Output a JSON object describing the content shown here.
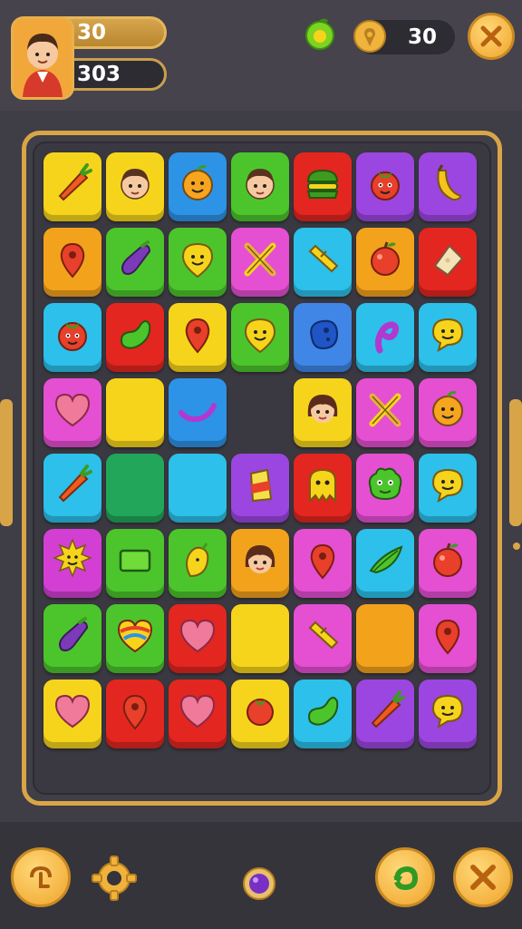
{
  "hud": {
    "level_value": "30",
    "score_value": "303",
    "coins_value": "30"
  },
  "colors": {
    "yellow": "#f6d41c",
    "blue": "#2d93e6",
    "green": "#4cc52c",
    "red": "#e3261f",
    "purple": "#9b46e0",
    "orange": "#f3a21b",
    "cyan": "#2cc0ea",
    "pink": "#e54fd2",
    "dgreen": "#22a65a",
    "lblue": "#3f86e6",
    "magenta": "#d33fd3",
    "gold": "#d9a548"
  },
  "board": {
    "rows": 8,
    "cols": 7,
    "tiles": [
      {
        "row": 0,
        "col": 0,
        "color": "yellow",
        "icon": "carrot-icon"
      },
      {
        "row": 0,
        "col": 1,
        "color": "yellow",
        "icon": "boy-face-icon"
      },
      {
        "row": 0,
        "col": 2,
        "color": "blue",
        "icon": "orange-face-icon"
      },
      {
        "row": 0,
        "col": 3,
        "color": "green",
        "icon": "boy-face-icon"
      },
      {
        "row": 0,
        "col": 4,
        "color": "red",
        "icon": "burger-icon"
      },
      {
        "row": 0,
        "col": 5,
        "color": "purple",
        "icon": "tomato-face-icon"
      },
      {
        "row": 0,
        "col": 6,
        "color": "purple",
        "icon": "banana-icon"
      },
      {
        "row": 1,
        "col": 0,
        "color": "orange",
        "icon": "pepper-icon"
      },
      {
        "row": 1,
        "col": 1,
        "color": "green",
        "icon": "eggplant-icon"
      },
      {
        "row": 1,
        "col": 2,
        "color": "green",
        "icon": "smiley-icon"
      },
      {
        "row": 1,
        "col": 3,
        "color": "pink",
        "icon": "crossed-sticks-icon"
      },
      {
        "row": 1,
        "col": 4,
        "color": "cyan",
        "icon": "bar-icon"
      },
      {
        "row": 1,
        "col": 5,
        "color": "orange",
        "icon": "apple-icon"
      },
      {
        "row": 1,
        "col": 6,
        "color": "red",
        "icon": "cheese-icon"
      },
      {
        "row": 2,
        "col": 0,
        "color": "cyan",
        "icon": "tomato-face-icon"
      },
      {
        "row": 2,
        "col": 1,
        "color": "red",
        "icon": "bean-icon"
      },
      {
        "row": 2,
        "col": 2,
        "color": "yellow",
        "icon": "pepper-icon"
      },
      {
        "row": 2,
        "col": 3,
        "color": "green",
        "icon": "smiley-icon"
      },
      {
        "row": 2,
        "col": 4,
        "color": "lblue",
        "icon": "blob-icon"
      },
      {
        "row": 2,
        "col": 5,
        "color": "cyan",
        "icon": "swirl-icon"
      },
      {
        "row": 2,
        "col": 6,
        "color": "cyan",
        "icon": "speech-smiley-icon"
      },
      {
        "row": 3,
        "col": 0,
        "color": "pink",
        "icon": "heart-icon"
      },
      {
        "row": 3,
        "col": 1,
        "color": "yellow",
        "icon": ""
      },
      {
        "row": 3,
        "col": 2,
        "color": "blue",
        "icon": "curve-icon"
      },
      {
        "row": 3,
        "col": 4,
        "color": "yellow",
        "icon": "girl-face-icon"
      },
      {
        "row": 3,
        "col": 5,
        "color": "pink",
        "icon": "crossed-sticks-icon"
      },
      {
        "row": 3,
        "col": 6,
        "color": "pink",
        "icon": "orange-face-icon"
      },
      {
        "row": 4,
        "col": 0,
        "color": "cyan",
        "icon": "carrot-icon"
      },
      {
        "row": 4,
        "col": 1,
        "color": "dgreen",
        "icon": ""
      },
      {
        "row": 4,
        "col": 2,
        "color": "cyan",
        "icon": ""
      },
      {
        "row": 4,
        "col": 3,
        "color": "purple",
        "icon": "candy-icon"
      },
      {
        "row": 4,
        "col": 4,
        "color": "red",
        "icon": "ghost-icon"
      },
      {
        "row": 4,
        "col": 5,
        "color": "pink",
        "icon": "monster-icon"
      },
      {
        "row": 4,
        "col": 6,
        "color": "cyan",
        "icon": "speech-smiley-icon"
      },
      {
        "row": 5,
        "col": 0,
        "color": "magenta",
        "icon": "sun-face-icon"
      },
      {
        "row": 5,
        "col": 1,
        "color": "green",
        "icon": "rectangle-icon"
      },
      {
        "row": 5,
        "col": 2,
        "color": "green",
        "icon": "mango-icon"
      },
      {
        "row": 5,
        "col": 3,
        "color": "orange",
        "icon": "girl-face-icon"
      },
      {
        "row": 5,
        "col": 4,
        "color": "pink",
        "icon": "pepper-icon"
      },
      {
        "row": 5,
        "col": 5,
        "color": "cyan",
        "icon": "leaf-icon"
      },
      {
        "row": 5,
        "col": 6,
        "color": "pink",
        "icon": "apple-icon"
      },
      {
        "row": 6,
        "col": 0,
        "color": "green",
        "icon": "eggplant-icon"
      },
      {
        "row": 6,
        "col": 1,
        "color": "green",
        "icon": "rainbow-heart-icon"
      },
      {
        "row": 6,
        "col": 2,
        "color": "red",
        "icon": "heart-icon"
      },
      {
        "row": 6,
        "col": 3,
        "color": "yellow",
        "icon": ""
      },
      {
        "row": 6,
        "col": 4,
        "color": "pink",
        "icon": "bar-icon"
      },
      {
        "row": 6,
        "col": 5,
        "color": "orange",
        "icon": ""
      },
      {
        "row": 6,
        "col": 6,
        "color": "pink",
        "icon": "pepper-icon"
      },
      {
        "row": 7,
        "col": 0,
        "color": "yellow",
        "icon": "heart-icon"
      },
      {
        "row": 7,
        "col": 1,
        "color": "red",
        "icon": "pepper-icon"
      },
      {
        "row": 7,
        "col": 2,
        "color": "red",
        "icon": "heart-icon"
      },
      {
        "row": 7,
        "col": 3,
        "color": "yellow",
        "icon": "tomato-icon"
      },
      {
        "row": 7,
        "col": 4,
        "color": "cyan",
        "icon": "bean-icon"
      },
      {
        "row": 7,
        "col": 5,
        "color": "purple",
        "icon": "carrot-icon"
      },
      {
        "row": 7,
        "col": 6,
        "color": "purple",
        "icon": "speech-smiley-icon"
      }
    ]
  },
  "toolbar": {
    "top_icons": [
      "apple-gem-icon",
      "pin-coin-icon",
      "close-icon"
    ],
    "bottom_icons": [
      "shuffle-icon",
      "gear-icon",
      "purple-gem-icon",
      "refresh-icon",
      "close-icon"
    ]
  }
}
